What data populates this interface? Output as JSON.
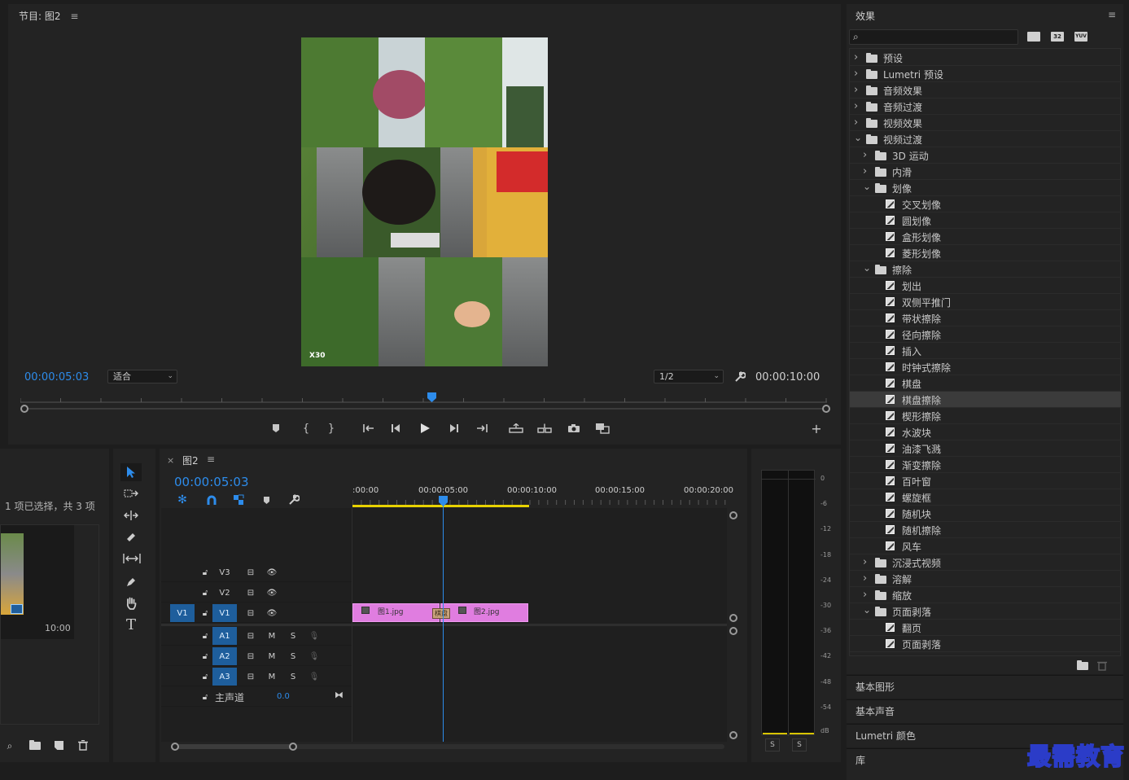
{
  "program_monitor": {
    "title": "节目: 图2",
    "menu_icon": "≡",
    "current_time": "00:00:05:03",
    "fit_option": "适合",
    "resolution": "1/2",
    "duration": "00:00:10:00",
    "watermark": "X30",
    "playhead_fraction": 0.51
  },
  "project": {
    "selection_text": "1 项已选择，共 3 项",
    "thumb_duration": "10:00"
  },
  "timeline": {
    "tab_close": "×",
    "title": "图2",
    "menu_icon": "≡",
    "current_time": "00:00:05:03",
    "ruler_labels": [
      ":00:00",
      "00:00:05:00",
      "00:00:10:00",
      "00:00:15:00",
      "00:00:20:00"
    ],
    "video_tracks": [
      {
        "name": "V3",
        "source": ""
      },
      {
        "name": "V2",
        "source": ""
      },
      {
        "name": "V1",
        "source": "V1"
      }
    ],
    "audio_tracks": [
      {
        "name": "A1",
        "m": "M",
        "s": "S"
      },
      {
        "name": "A2",
        "m": "M",
        "s": "S"
      },
      {
        "name": "A3",
        "m": "M",
        "s": "S"
      }
    ],
    "master": {
      "label": "主声道",
      "value": "0.0"
    },
    "clips": [
      {
        "name": "图1.jpg",
        "fx": "fx"
      },
      {
        "name": "图2.jpg",
        "fx": "fx"
      }
    ],
    "transition_label": "棋盘"
  },
  "audio_meter": {
    "scale": [
      "0",
      "-6",
      "-12",
      "-18",
      "-24",
      "-30",
      "-36",
      "-42",
      "-48",
      "-54",
      "dB"
    ],
    "solo_buttons": [
      "S",
      "S"
    ]
  },
  "effects": {
    "title": "效果",
    "menu_icon": "≡",
    "search_placeholder": "",
    "badges": [
      "32",
      "YUV"
    ],
    "tree": [
      {
        "label": "预设",
        "level": 0,
        "type": "preset",
        "expanded": false
      },
      {
        "label": "Lumetri 预设",
        "level": 0,
        "type": "preset",
        "expanded": false
      },
      {
        "label": "音频效果",
        "level": 0,
        "type": "folder",
        "expanded": false
      },
      {
        "label": "音频过渡",
        "level": 0,
        "type": "folder",
        "expanded": false
      },
      {
        "label": "视频效果",
        "level": 0,
        "type": "folder",
        "expanded": false
      },
      {
        "label": "视频过渡",
        "level": 0,
        "type": "folder",
        "expanded": true
      },
      {
        "label": "3D 运动",
        "level": 1,
        "type": "folder",
        "expanded": false
      },
      {
        "label": "内滑",
        "level": 1,
        "type": "folder",
        "expanded": false
      },
      {
        "label": "划像",
        "level": 1,
        "type": "folder",
        "expanded": true
      },
      {
        "label": "交叉划像",
        "level": 2,
        "type": "fx"
      },
      {
        "label": "圆划像",
        "level": 2,
        "type": "fx"
      },
      {
        "label": "盒形划像",
        "level": 2,
        "type": "fx"
      },
      {
        "label": "菱形划像",
        "level": 2,
        "type": "fx"
      },
      {
        "label": "擦除",
        "level": 1,
        "type": "folder",
        "expanded": true
      },
      {
        "label": "划出",
        "level": 2,
        "type": "fx"
      },
      {
        "label": "双侧平推门",
        "level": 2,
        "type": "fx"
      },
      {
        "label": "带状擦除",
        "level": 2,
        "type": "fx"
      },
      {
        "label": "径向擦除",
        "level": 2,
        "type": "fx"
      },
      {
        "label": "插入",
        "level": 2,
        "type": "fx"
      },
      {
        "label": "时钟式擦除",
        "level": 2,
        "type": "fx"
      },
      {
        "label": "棋盘",
        "level": 2,
        "type": "fx"
      },
      {
        "label": "棋盘擦除",
        "level": 2,
        "type": "fx",
        "selected": true
      },
      {
        "label": "楔形擦除",
        "level": 2,
        "type": "fx"
      },
      {
        "label": "水波块",
        "level": 2,
        "type": "fx"
      },
      {
        "label": "油漆飞溅",
        "level": 2,
        "type": "fx"
      },
      {
        "label": "渐变擦除",
        "level": 2,
        "type": "fx"
      },
      {
        "label": "百叶窗",
        "level": 2,
        "type": "fx"
      },
      {
        "label": "螺旋框",
        "level": 2,
        "type": "fx"
      },
      {
        "label": "随机块",
        "level": 2,
        "type": "fx"
      },
      {
        "label": "随机擦除",
        "level": 2,
        "type": "fx"
      },
      {
        "label": "风车",
        "level": 2,
        "type": "fx"
      },
      {
        "label": "沉浸式视频",
        "level": 1,
        "type": "folder",
        "expanded": false
      },
      {
        "label": "溶解",
        "level": 1,
        "type": "folder",
        "expanded": false
      },
      {
        "label": "缩放",
        "level": 1,
        "type": "folder",
        "expanded": false
      },
      {
        "label": "页面剥落",
        "level": 1,
        "type": "folder",
        "expanded": true
      },
      {
        "label": "翻页",
        "level": 2,
        "type": "fx"
      },
      {
        "label": "页面剥落",
        "level": 2,
        "type": "fx"
      }
    ],
    "sections": [
      "基本图形",
      "基本声音",
      "Lumetri 颜色",
      "库"
    ]
  },
  "brand_watermark": "最需教育",
  "colors": {
    "accent_blue": "#2d8ceb",
    "clip_pink": "#e07de0",
    "track_blue": "#1e5e9c",
    "panel": "#232323"
  }
}
